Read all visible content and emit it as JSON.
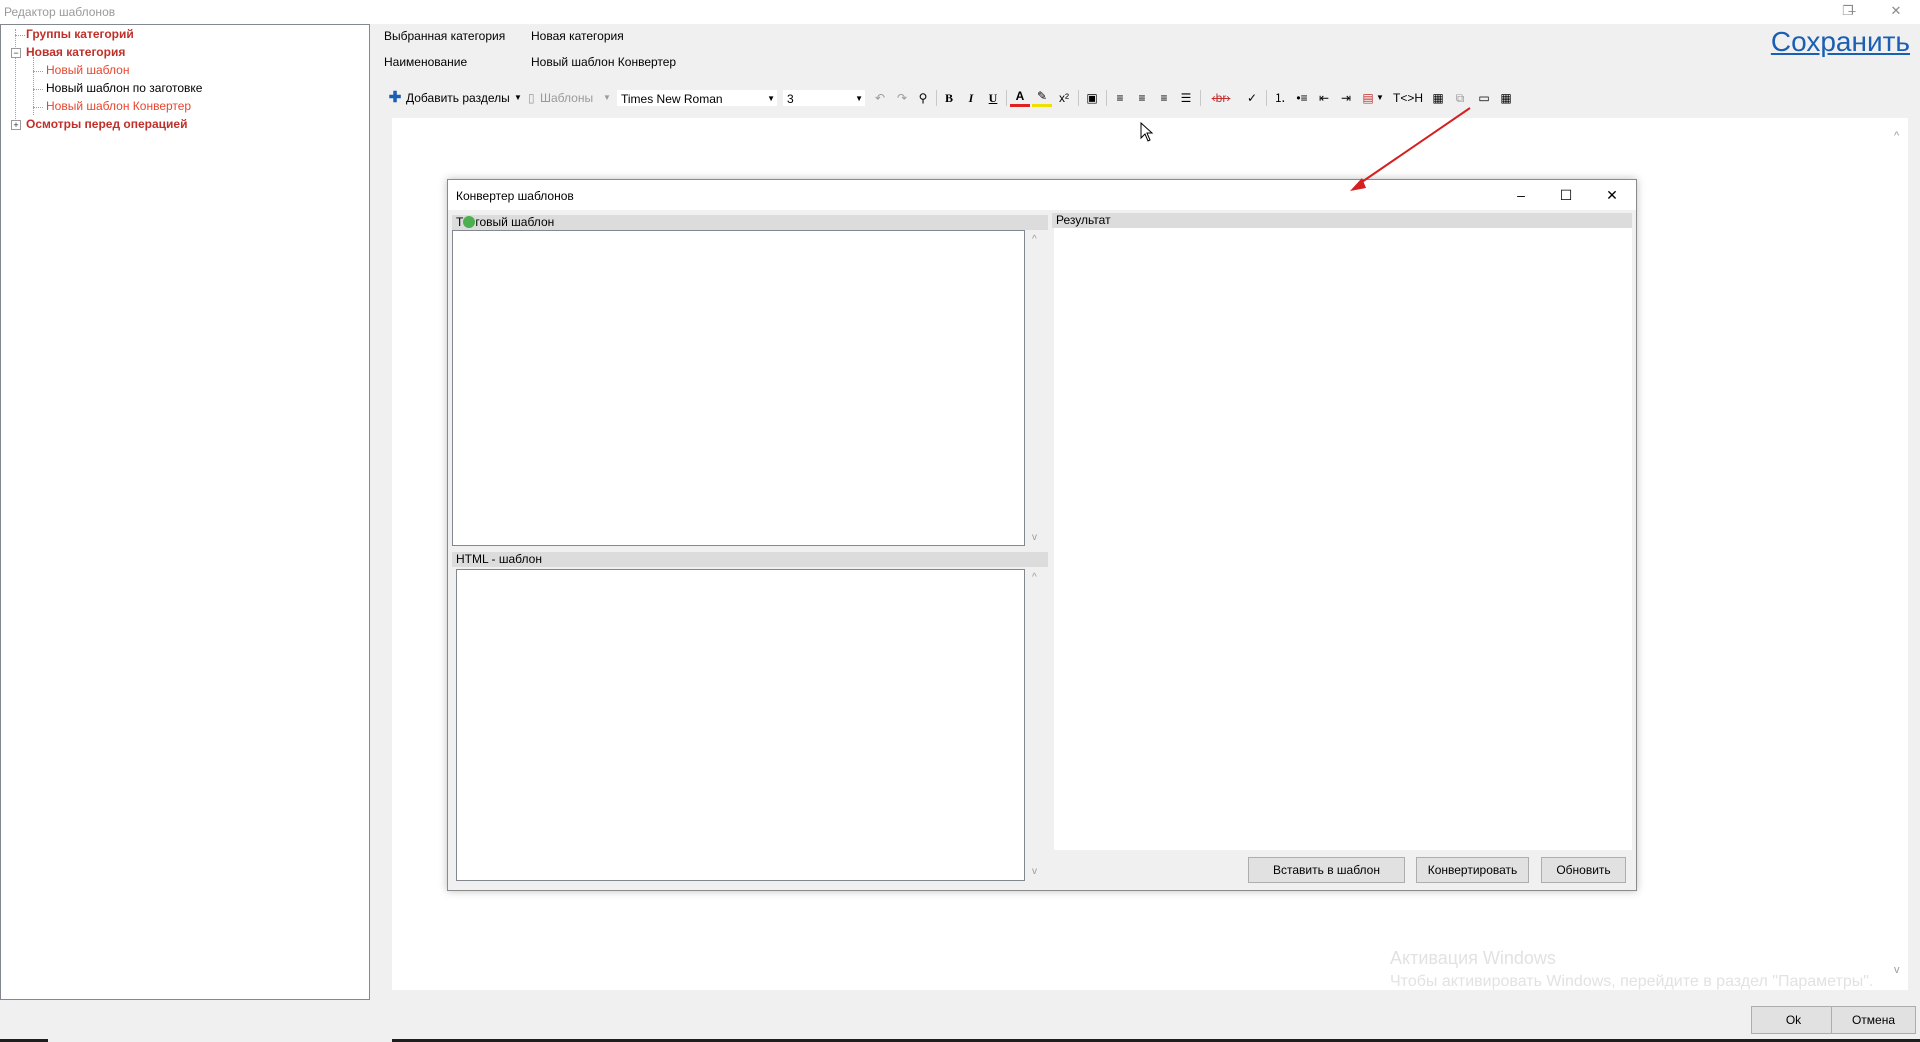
{
  "window": {
    "title": "Редактор шаблонов",
    "controls": [
      "–",
      "❐",
      "✕"
    ]
  },
  "tree": {
    "items": [
      {
        "label": "Группы категорий",
        "style": "red-b"
      },
      {
        "label": "Новая категория",
        "style": "red-b"
      },
      {
        "label": "Новый шаблон",
        "style": "red"
      },
      {
        "label": "Новый шаблон по заготовке",
        "style": "blk"
      },
      {
        "label": "Новый шаблон Конвертер",
        "style": "red"
      },
      {
        "label": "Осмотры перед операцией",
        "style": "red-b"
      }
    ]
  },
  "header": {
    "category_label": "Выбранная категория",
    "category_value": "Новая категория",
    "name_label": "Наименование",
    "name_value": "Новый шаблон Конвертер",
    "save_link": "Сохранить"
  },
  "toolbar": {
    "add_sections": "Добавить разделы",
    "templates": "Шаблоны",
    "font": "Times New Roman",
    "size": "3",
    "bold": "B",
    "italic": "I",
    "underline": "U",
    "text_to_html": "T<>H"
  },
  "dialog": {
    "title": "Конвертер шаблонов",
    "text_template_label_a": "Т",
    "text_template_label_b": "говый шаблон",
    "html_template_label": "HTML - шаблон",
    "result_label": "Результат",
    "insert_button": "Вставить в шаблон",
    "convert_button": "Конвертировать",
    "refresh_button": "Обновить"
  },
  "footer": {
    "ok_button": "Ok",
    "cancel_button": "Отмена",
    "watermark_line1": "Активация Windows",
    "watermark_line2": "Чтобы активировать Windows, перейдите в раздел \"Параметры\"."
  },
  "colors": {
    "link_blue": "#1a5fb4",
    "tree_red_bold": "#c0302a",
    "tree_red": "#e8452f",
    "arrow_red": "#d42020"
  }
}
